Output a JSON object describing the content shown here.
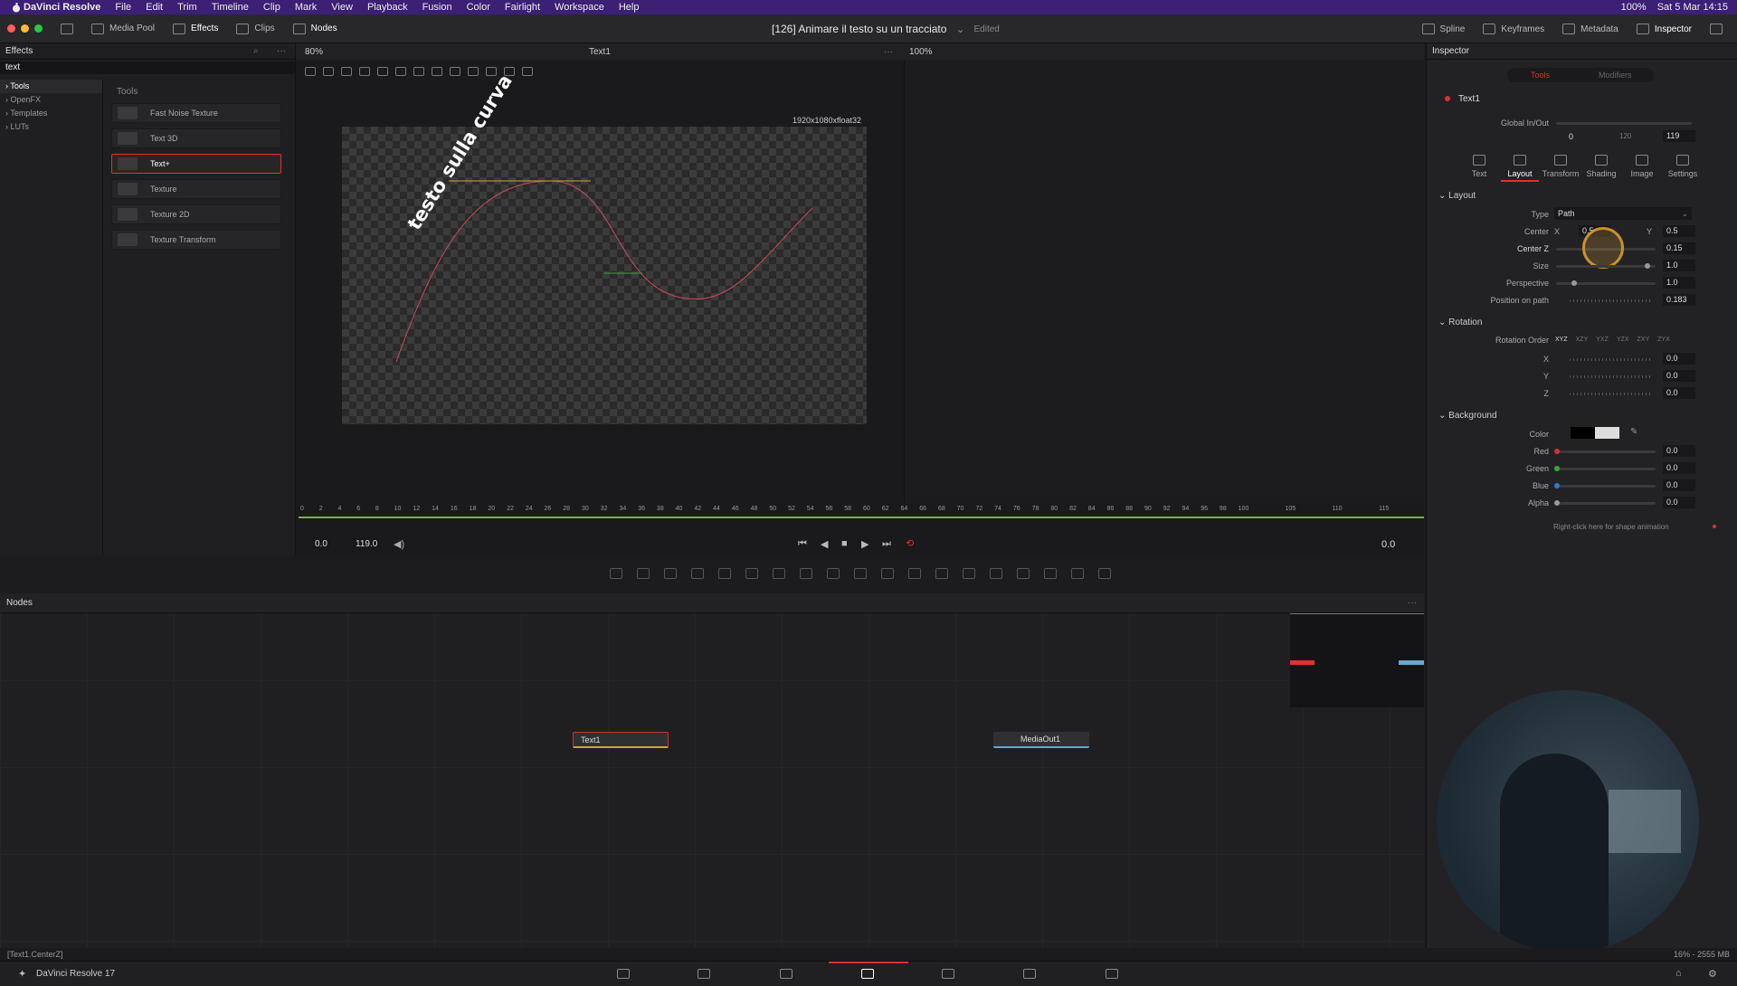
{
  "mac_menu": {
    "app_name": "DaVinci Resolve",
    "items": [
      "File",
      "Edit",
      "Trim",
      "Timeline",
      "Clip",
      "Mark",
      "View",
      "Playback",
      "Fusion",
      "Color",
      "Fairlight",
      "Workspace",
      "Help"
    ],
    "battery": "100%",
    "clock": "Sat 5 Mar  14:15"
  },
  "toolbar": {
    "media_pool": "Media Pool",
    "effects": "Effects",
    "clips": "Clips",
    "nodes": "Nodes",
    "project_title": "[126] Animare il testo su un tracciato",
    "edited": "Edited",
    "spline": "Spline",
    "keyframes": "Keyframes",
    "metadata": "Metadata",
    "inspector": "Inspector"
  },
  "effects_panel": {
    "title": "Effects",
    "search_value": "text",
    "tree": [
      "Tools",
      "OpenFX",
      "Templates",
      "LUTs"
    ],
    "category": "Tools",
    "items": [
      "Fast Noise Texture",
      "Text 3D",
      "Text+",
      "Texture",
      "Texture 2D",
      "Texture Transform"
    ],
    "selected_index": 2
  },
  "viewer": {
    "zoom": "80%",
    "title": "Text1",
    "zoom_right": "100%",
    "resolution": "1920x1080xfloat32",
    "canvas_text": "testo sulla curva"
  },
  "timeline": {
    "ticks": [
      "0",
      "2",
      "4",
      "6",
      "8",
      "10",
      "12",
      "14",
      "16",
      "18",
      "20",
      "22",
      "24",
      "26",
      "28",
      "30",
      "32",
      "34",
      "36",
      "38",
      "40",
      "42",
      "44",
      "46",
      "48",
      "50",
      "52",
      "54",
      "56",
      "58",
      "60",
      "62",
      "64",
      "66",
      "68",
      "70",
      "72",
      "74",
      "76",
      "78",
      "80",
      "82",
      "84",
      "86",
      "88",
      "90",
      "92",
      "94",
      "96",
      "98",
      "100",
      "105",
      "110",
      "115"
    ],
    "start": "0.0",
    "end": "119.0",
    "current": "0.0"
  },
  "nodes_panel": {
    "title": "Nodes",
    "node_text1": "Text1",
    "node_mediaout": "MediaOut1"
  },
  "inspector": {
    "title": "Inspector",
    "tab_tools": "Tools",
    "tab_modifiers": "Modifiers",
    "node_name": "Text1",
    "global_label": "Global In/Out",
    "global_in": "0",
    "global_mid": "120",
    "global_out": "119",
    "subtabs": [
      "Text",
      "Layout",
      "Transform",
      "Shading",
      "Image",
      "Settings"
    ],
    "active_subtab": "Layout",
    "layout": {
      "section": "Layout",
      "type_label": "Type",
      "type_value": "Path",
      "center_label": "Center",
      "x_label": "X",
      "center_x": "0.5",
      "y_label": "Y",
      "center_y": "0.5",
      "centerz_label": "Center Z",
      "centerz": "0.15",
      "size_label": "Size",
      "size": "1.0",
      "persp_label": "Perspective",
      "persp": "1.0",
      "pop_label": "Position on path",
      "pop": "0.183"
    },
    "rotation": {
      "section": "Rotation",
      "order_label": "Rotation Order",
      "orders": [
        "XYZ",
        "XZY",
        "YXZ",
        "YZX",
        "ZXY",
        "ZYX"
      ],
      "x_label": "X",
      "x": "0.0",
      "y_label": "Y",
      "y": "0.0",
      "z_label": "Z",
      "z": "0.0"
    },
    "background": {
      "section": "Background",
      "color_label": "Color",
      "red_label": "Red",
      "red": "0.0",
      "green_label": "Green",
      "green": "0.0",
      "blue_label": "Blue",
      "blue": "0.0",
      "alpha_label": "Alpha",
      "alpha": "0.0"
    },
    "hint": "Right-click here for shape animation"
  },
  "status": {
    "left": "[Text1.CenterZ]",
    "right": "16% - 2555 MB"
  },
  "dock": {
    "app": "DaVinci Resolve 17"
  },
  "colors": {
    "accent_red": "#e0302e",
    "menu_bar": "#3d1f76",
    "timeline_green": "#7ab04c"
  }
}
